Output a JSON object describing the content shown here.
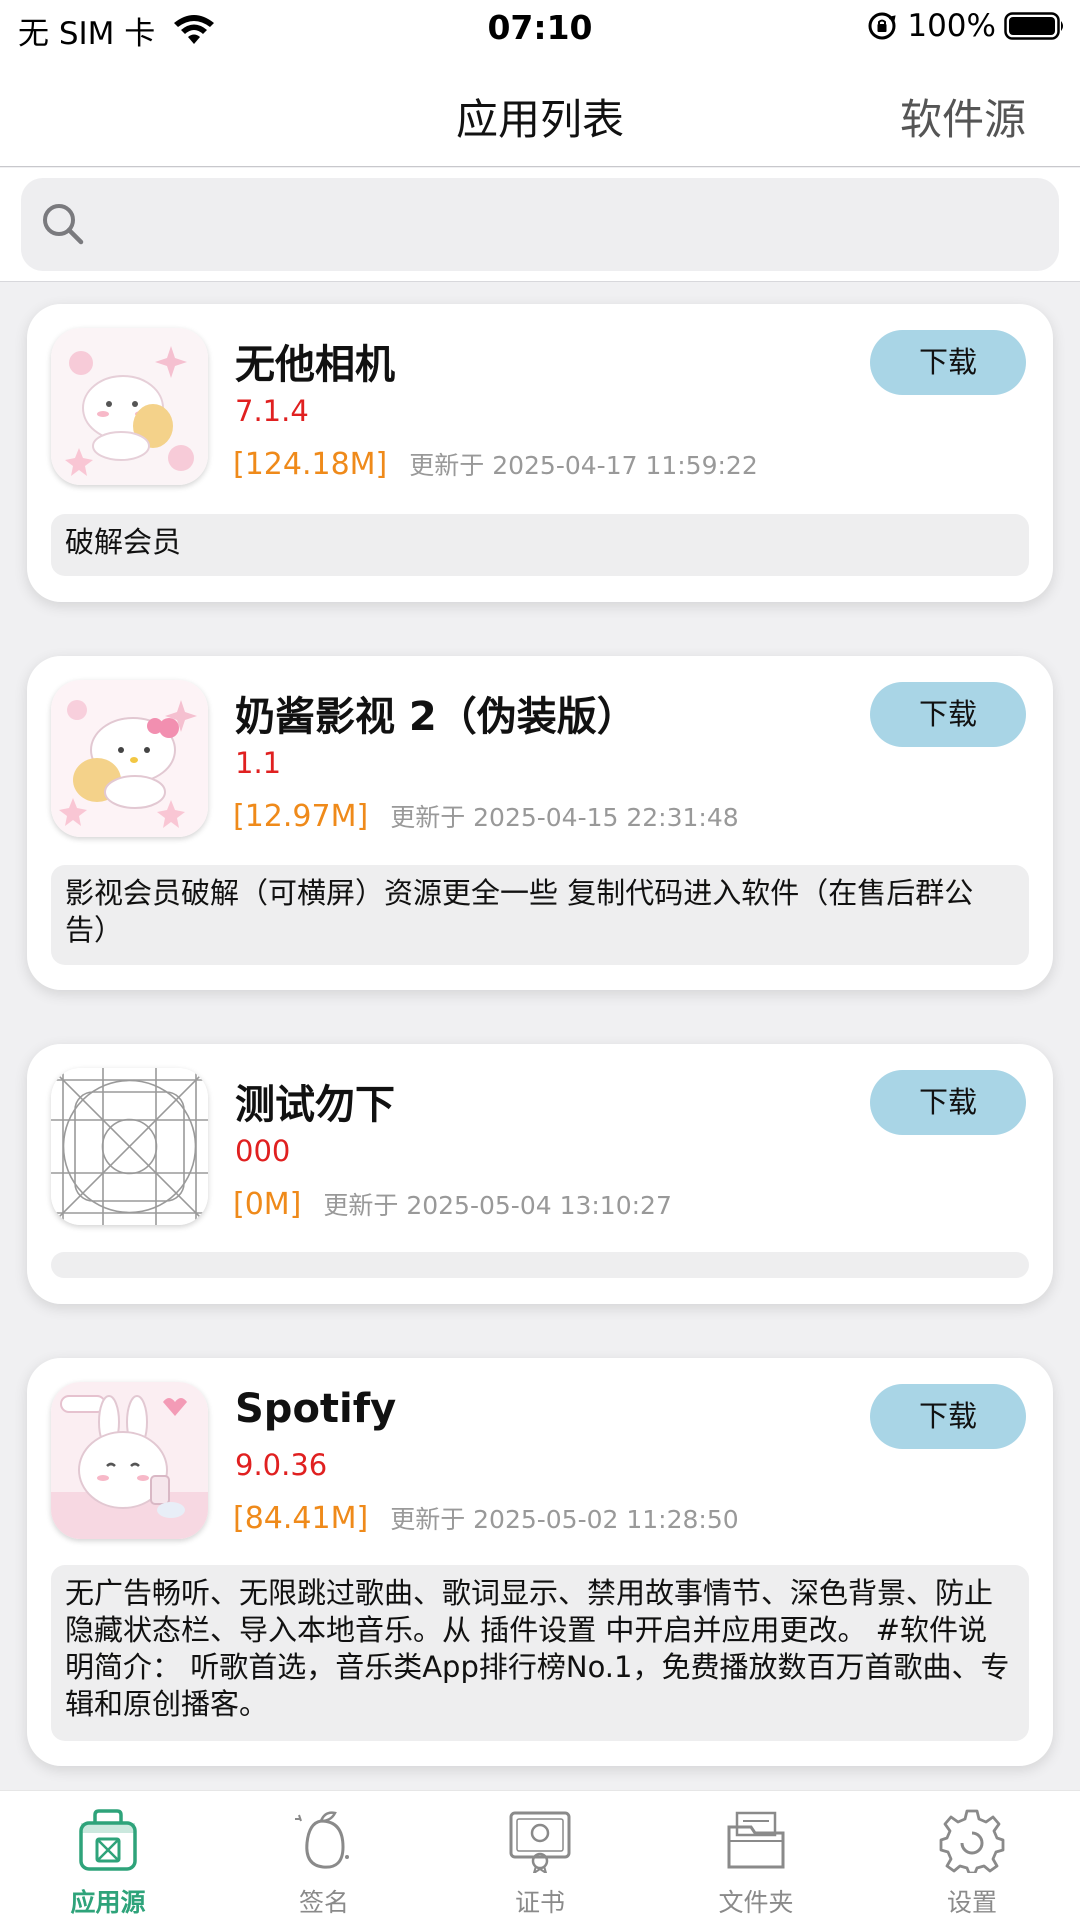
{
  "status_bar": {
    "carrier": "无 SIM 卡",
    "time": "07:10",
    "battery": "100%"
  },
  "nav": {
    "title": "应用列表",
    "right_label": "软件源"
  },
  "search": {
    "placeholder": ""
  },
  "apps": [
    {
      "name": "无他相机",
      "version": "7.1.4",
      "size": "[124.18M]",
      "updated": "更新于 2025-04-17 11:59:22",
      "description": "破解会员",
      "button": "下载",
      "icon": "kitten-bread-icon"
    },
    {
      "name": "奶酱影视 2（伪装版）",
      "version": "1.1",
      "size": "[12.97M]",
      "updated": "更新于 2025-04-15 22:31:48",
      "description": "影视会员破解（可横屏）资源更全一些 复制代码进入软件（在售后群公告）",
      "button": "下载",
      "icon": "hello-kitty-icon"
    },
    {
      "name": "测试勿下",
      "version": "000",
      "size": "[0M]",
      "updated": "更新于 2025-05-04 13:10:27",
      "description": "",
      "button": "下载",
      "icon": "placeholder-grid-icon"
    },
    {
      "name": "Spotify",
      "version": "9.0.36",
      "size": "[84.41M]",
      "updated": "更新于 2025-05-02 11:28:50",
      "description": "无广告畅听、无限跳过歌曲、歌词显示、禁用故事情节、深色背景、防止隐藏状态栏、导入本地音乐。从 插件设置 中开启并应用更改。 #软件说明简介： 听歌首选，音乐类App排行榜No.1，免费播放数百万首歌曲、专辑和原创播客。",
      "button": "下载",
      "icon": "bunny-phone-icon"
    }
  ],
  "tabs": [
    {
      "label": "应用源",
      "icon": "app-source-icon",
      "active": true
    },
    {
      "label": "签名",
      "icon": "mango-icon",
      "active": false
    },
    {
      "label": "证书",
      "icon": "certificate-icon",
      "active": false
    },
    {
      "label": "文件夹",
      "icon": "folder-icon",
      "active": false
    },
    {
      "label": "设置",
      "icon": "gear-icon",
      "active": false
    }
  ],
  "colors": {
    "accent": "#2ea37a",
    "download_button": "#a9d5e6",
    "version": "#e02020",
    "size": "#ef8a1a"
  }
}
